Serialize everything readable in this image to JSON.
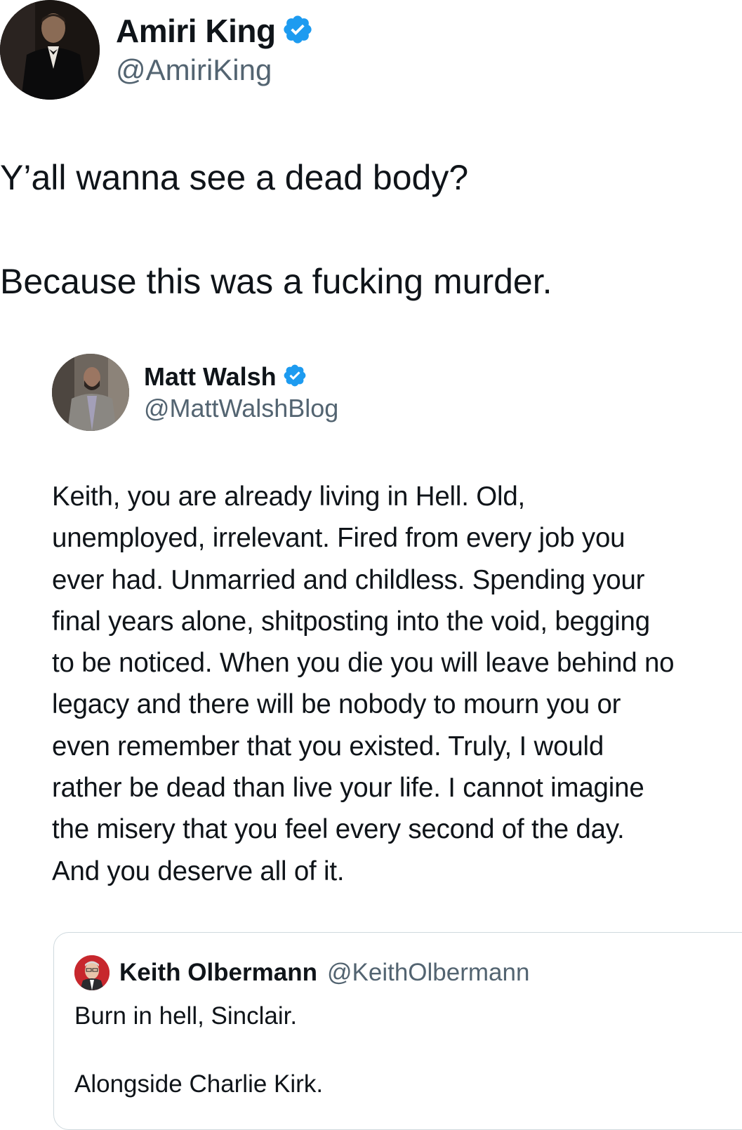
{
  "outer_tweet": {
    "author": {
      "name": "Amiri King",
      "handle": "@AmiriKing",
      "verified": true
    },
    "text_line_1": "Y’all wanna see a dead body?",
    "text_line_2": "Because this was a fucking murder."
  },
  "quoted_tweet": {
    "author": {
      "name": "Matt Walsh",
      "handle": "@MattWalshBlog",
      "verified": true
    },
    "lines": [
      "Keith, you are already living in Hell. Old,",
      "unemployed, irrelevant. Fired from every job you",
      "ever had. Unmarried and childless. Spending your",
      "final years alone, shitposting into the void, begging",
      "to be noticed. When you die you will leave behind no",
      "legacy and there will be nobody to mourn you or",
      "even remember that you existed. Truly, I would",
      "rather be dead than live your life. I cannot imagine",
      "the misery that you feel every second of the day.",
      "And you deserve all of it."
    ]
  },
  "nested_quote": {
    "author": {
      "name": "Keith Olbermann",
      "handle": "@KeithOlbermann"
    },
    "text_line_1": "Burn in hell, Sinclair.",
    "text_line_2": "Alongside Charlie Kirk."
  },
  "colors": {
    "text": "#0f1419",
    "secondary_text": "#536471",
    "verified_badge": "#1d9bf0",
    "card_border": "#cfd9de"
  }
}
